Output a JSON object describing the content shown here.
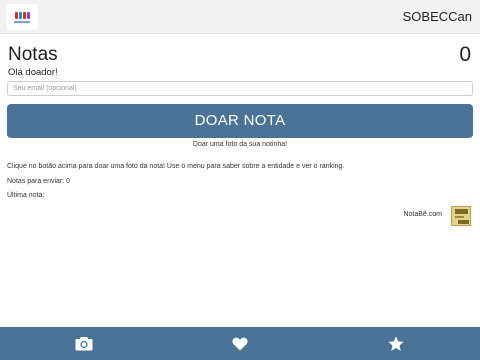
{
  "header": {
    "org_name": "SOBECCan",
    "logo_icon": "organization-logo"
  },
  "main": {
    "title": "Notas",
    "count": "0",
    "greeting": "Olá doador!",
    "email_placeholder": "Seu email (opcional)",
    "donate_button_label": "DOAR NOTA",
    "donate_hint": "Doar uma foto da sua notinha!",
    "instructions": "Clique no botão acima para doar uma foto da nota! Use o menu para saber sobre a entidade e ver o ranking.",
    "pending_label": "Notas para enviar: 0",
    "last_note_label": "Última nota:"
  },
  "credit": {
    "text": "NotaBê.com",
    "logo_icon": "notabe-logo"
  },
  "tabs": [
    {
      "icon": "camera-icon",
      "active": true
    },
    {
      "icon": "heart-icon",
      "active": false
    },
    {
      "icon": "star-icon",
      "active": false
    }
  ],
  "colors": {
    "accent": "#4a7396",
    "topbar": "#f2f2f2",
    "text": "#222222"
  }
}
